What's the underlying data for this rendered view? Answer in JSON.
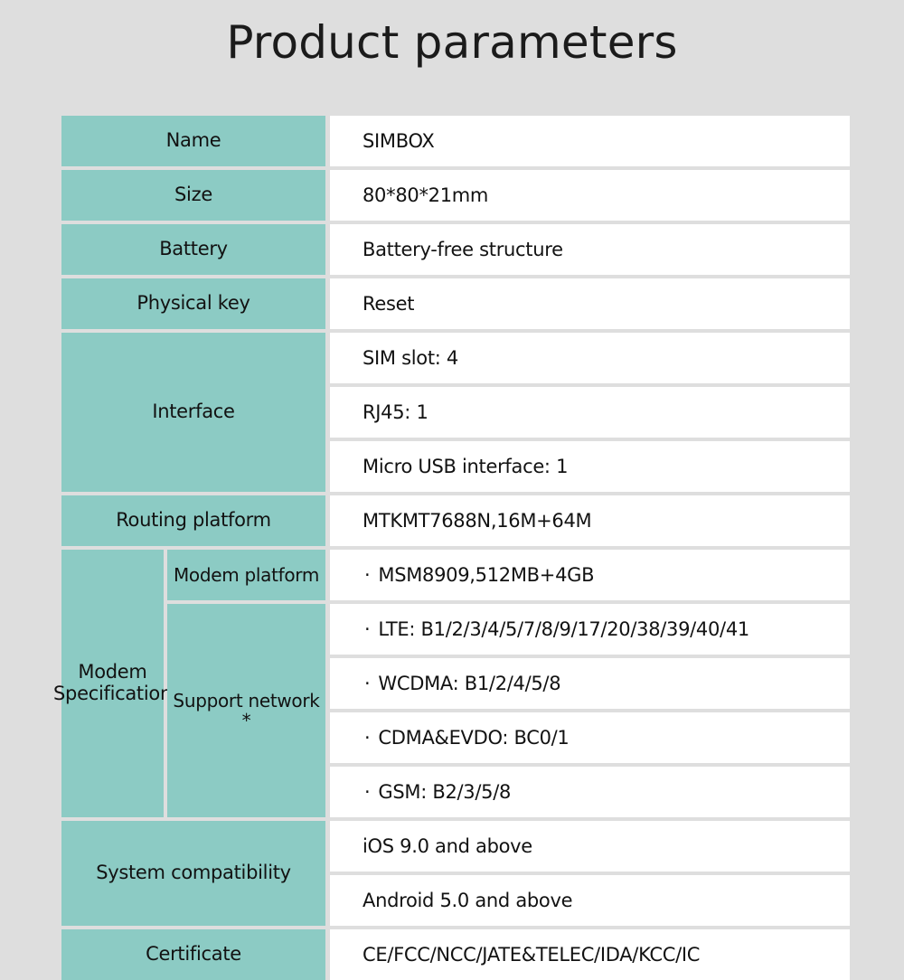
{
  "title": "Product parameters",
  "colors": {
    "background": "#dedede",
    "key_cell": "#8ccbc4",
    "value_cell": "#ffffff",
    "text": "#121212"
  },
  "rows": {
    "name": {
      "label": "Name",
      "value": "SIMBOX"
    },
    "size": {
      "label": "Size",
      "value": "80*80*21mm"
    },
    "battery": {
      "label": "Battery",
      "value": "Battery-free structure"
    },
    "physical_key": {
      "label": "Physical key",
      "value": "Reset"
    },
    "interface": {
      "label": "Interface",
      "values": [
        "SIM slot: 4",
        "RJ45: 1",
        "Micro USB interface: 1"
      ]
    },
    "routing_platform": {
      "label": "Routing platform",
      "value": "MTKMT7688N,16M+64M"
    },
    "modem": {
      "label": "Modem\nSpecification",
      "platform": {
        "label": "Modem platform",
        "value": "MSM8909,512MB+4GB"
      },
      "support_network": {
        "label": "Support network *",
        "values": [
          "LTE:  B1/2/3/4/5/7/8/9/17/20/38/39/40/41",
          "WCDMA:  B1/2/4/5/8",
          "CDMA&EVDO:  BC0/1",
          "GSM:  B2/3/5/8"
        ]
      },
      "bullet": "·"
    },
    "system_compatibility": {
      "label": "System compatibility",
      "values": [
        "iOS 9.0 and above",
        "Android 5.0 and above"
      ]
    },
    "certificate": {
      "label": "Certificate",
      "value": "CE/FCC/NCC/JATE&TELEC/IDA/KCC/IC"
    }
  }
}
